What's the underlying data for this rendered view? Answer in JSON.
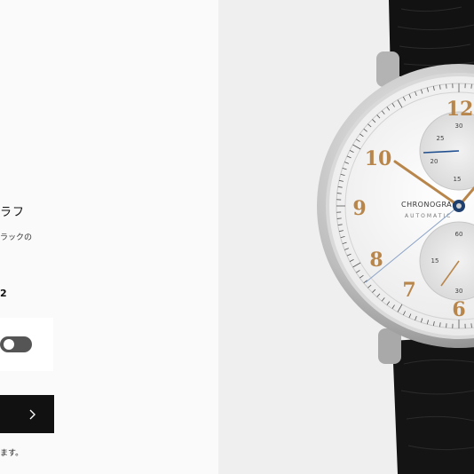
{
  "product": {
    "title_fragment": "ラフ",
    "description_fragment": "ラックの",
    "reference_fragment": "2"
  },
  "cta": {
    "icon": "chevron-right-icon"
  },
  "footer": {
    "note_fragment": "ます。"
  },
  "dial": {
    "brand_line1": "CHRONOGRAPH",
    "brand_line2": "AUTOMATIC",
    "numerals": [
      "12",
      "10",
      "9",
      "8",
      "7",
      "6"
    ]
  },
  "colors": {
    "cta_bg": "#111111",
    "toggle_bg": "#555555",
    "gold": "#b8864b"
  }
}
